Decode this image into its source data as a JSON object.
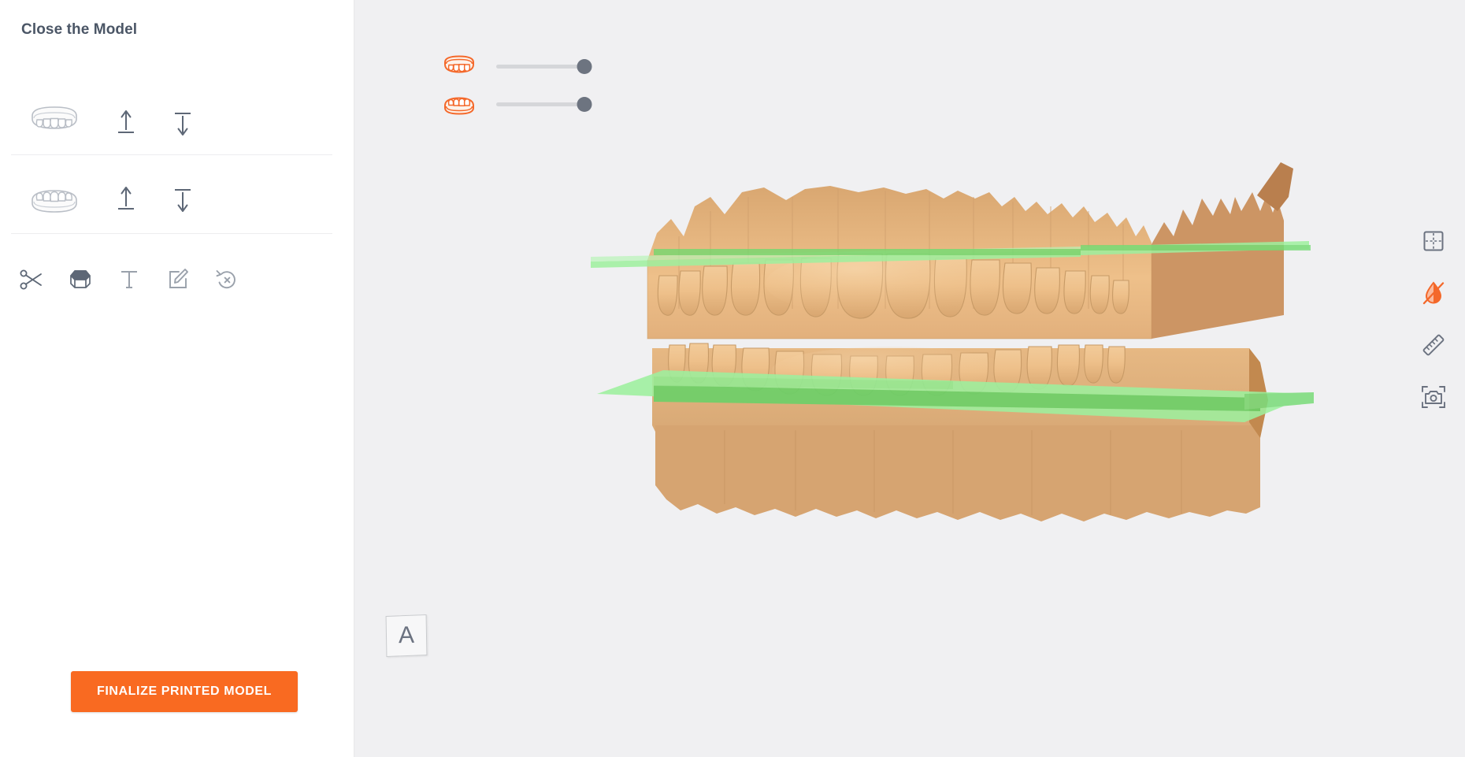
{
  "app": {
    "panel_title": "Close the Model",
    "accent_color": "#f96a21",
    "sidebar_bg": "#ffffff",
    "viewport_bg": "#f0f0f2"
  },
  "sidebar": {
    "arch_rows": [
      {
        "id": "upper",
        "arch_icon": "upper-jaw-icon",
        "arch_label": "Upper Jaw",
        "actions": [
          {
            "icon": "move-up-from-line-icon",
            "label": "Move Upper Up"
          },
          {
            "icon": "move-down-to-line-icon",
            "label": "Move Upper Down"
          }
        ]
      },
      {
        "id": "lower",
        "arch_icon": "lower-jaw-icon",
        "arch_label": "Lower Jaw",
        "actions": [
          {
            "icon": "move-up-to-line-icon",
            "label": "Move Lower Up"
          },
          {
            "icon": "move-down-from-line-icon",
            "label": "Move Lower Down"
          }
        ]
      }
    ],
    "tools": [
      {
        "icon": "scissors-icon",
        "label": "Trim"
      },
      {
        "icon": "model-base-icon",
        "label": "Base"
      },
      {
        "icon": "text-label-icon",
        "label": "Label Text"
      },
      {
        "icon": "edit-square-icon",
        "label": "Edit"
      },
      {
        "icon": "reset-undo-icon",
        "label": "Reset"
      }
    ],
    "finalize_button": {
      "label": "FINALIZE PRINTED MODEL",
      "color": "#f96a21",
      "text_color": "#ffffff"
    }
  },
  "viewport": {
    "sliders": [
      {
        "id": "upper-opacity-slider",
        "icon": "upper-jaw-orange-icon",
        "label": "Upper model visibility",
        "value": 100,
        "min": 0,
        "max": 100,
        "track_color": "#d5d6d9",
        "knob_color": "#6d7480"
      },
      {
        "id": "lower-opacity-slider",
        "icon": "lower-jaw-orange-icon",
        "label": "Lower model visibility",
        "value": 100,
        "min": 0,
        "max": 100,
        "track_color": "#d5d6d9",
        "knob_color": "#6d7480"
      }
    ],
    "orientation_cube": {
      "face_label": "A",
      "name": "view-orientation-cube"
    },
    "right_tools": [
      {
        "icon": "section-plane-icon",
        "label": "Section Plane",
        "color": "#6b7280",
        "active": false
      },
      {
        "icon": "no-shine-drop-icon",
        "label": "Toggle Shine",
        "color": "#f96a21",
        "active": true
      },
      {
        "icon": "ruler-icon",
        "label": "Measure",
        "color": "#6b7280",
        "active": false
      },
      {
        "icon": "camera-screenshot-icon",
        "label": "Screenshot",
        "color": "#6b7280",
        "active": false
      }
    ],
    "model": {
      "name": "dental-arch-3d-model",
      "material_color": "#eec08a",
      "material_shadow": "#c9945f",
      "cut_plane_color": "#9ef09e",
      "cut_plane_line_color": "#55d455",
      "planes": [
        "upper-trim-plane",
        "lower-trim-plane"
      ]
    }
  }
}
